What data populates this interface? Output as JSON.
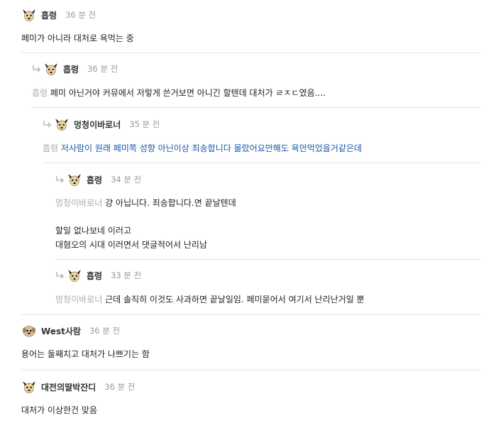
{
  "comments": [
    {
      "nick": "흡령",
      "time": "36 분 전",
      "mention": "",
      "text": "페미가 아니라 대처로 욕먹는 중"
    },
    {
      "nick": "흡령",
      "time": "36 분 전",
      "mention": "흡령",
      "text": "페미 아닌거야 커뮤에서 저렇게 쓴거보면 아니긴 할텐데 대처가 ㄹㅈㄷ였음...."
    },
    {
      "nick": "멍청이바로너",
      "time": "35 분 전",
      "mention": "흡령",
      "text": "저사람이 원래 페미쪽 성향 아닌이상 죄송합니다 몰랐어요만해도 욕안먹었을거같은데"
    },
    {
      "nick": "흡령",
      "time": "34 분 전",
      "mention": "멍청이바로너",
      "text": "걍 아닙니다. 죄송합니다.면 끝날텐데",
      "text2": "할일 없나보네 이러고",
      "text3": "대혐오의 시대 이러면서 댓글적어서 난리남"
    },
    {
      "nick": "흡령",
      "time": "33 분 전",
      "mention": "멍청이바로너",
      "text": "근데 솔직히 이것도 사과하면 끝날일임. 페미묻어서 여기서 난리난거일 뿐"
    },
    {
      "nick": "West사람",
      "time": "36 분 전",
      "mention": "",
      "text": "용어는 둘째치고 대처가 나쁘기는 함"
    },
    {
      "nick": "대전의딸박잔디",
      "time": "36 분 전",
      "mention": "",
      "text": "대처가 이상한건 맞음"
    }
  ]
}
